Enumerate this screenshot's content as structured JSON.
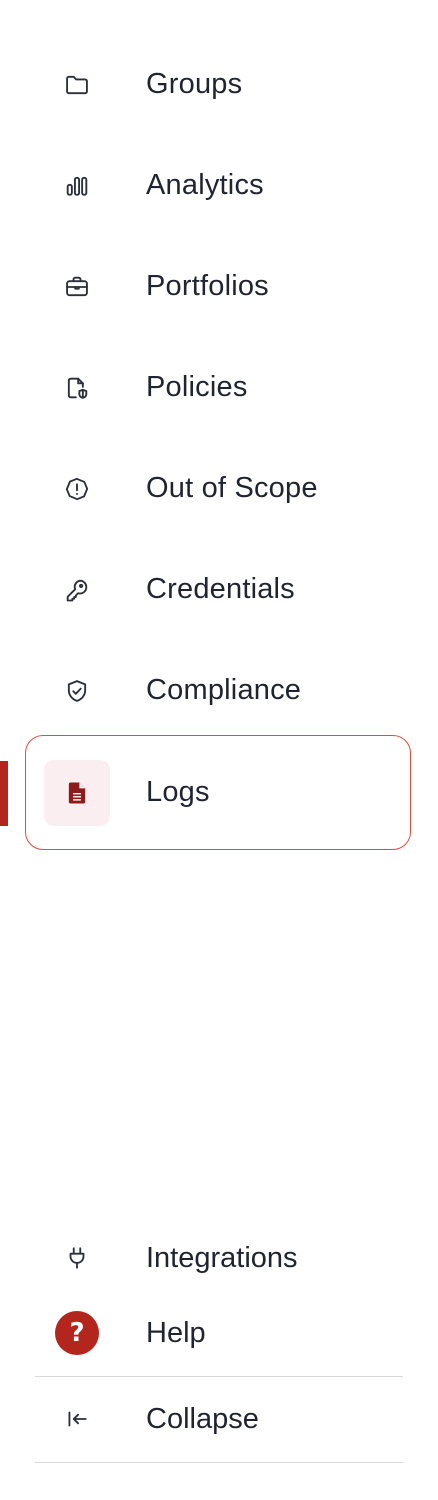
{
  "nav": {
    "items": [
      {
        "label": "Groups",
        "icon": "folder-icon"
      },
      {
        "label": "Analytics",
        "icon": "bar-chart-icon"
      },
      {
        "label": "Portfolios",
        "icon": "briefcase-icon"
      },
      {
        "label": "Policies",
        "icon": "document-shield-icon"
      },
      {
        "label": "Out of Scope",
        "icon": "alert-octagon-icon"
      },
      {
        "label": "Credentials",
        "icon": "key-icon"
      },
      {
        "label": "Compliance",
        "icon": "shield-check-icon"
      },
      {
        "label": "Logs",
        "icon": "file-text-icon",
        "active": true
      }
    ]
  },
  "footer": {
    "integrations_label": "Integrations",
    "integrations_icon": "plug-icon",
    "help_label": "Help",
    "help_icon": "help-icon",
    "help_glyph": "?",
    "collapse_label": "Collapse",
    "collapse_icon": "collapse-left-icon"
  },
  "colors": {
    "accent": "#b3261e",
    "active_border": "#d9503f",
    "active_bg": "#fbeef0",
    "text": "#1f2430",
    "divider": "#d6d8dc"
  }
}
